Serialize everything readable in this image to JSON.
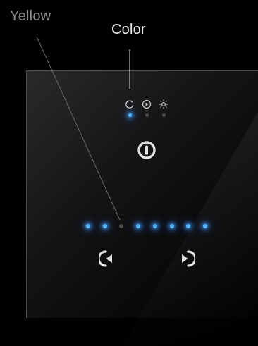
{
  "annotations": {
    "yellow_label": "Yellow",
    "color_label": "Color"
  },
  "modes": [
    {
      "icon": "cycle-icon",
      "selected": true
    },
    {
      "icon": "play-icon",
      "selected": false
    },
    {
      "icon": "sun-icon",
      "selected": false
    }
  ],
  "level_indicator": {
    "total": 8,
    "active_states": [
      true,
      true,
      false,
      true,
      true,
      true,
      true,
      true
    ]
  },
  "buttons": {
    "power": "power-icon",
    "previous": "previous-icon",
    "next": "next-icon"
  },
  "colors": {
    "indicator_on": "#59b7ff",
    "indicator_off": "#4a4a4a",
    "icon": "#d8d8d8"
  }
}
